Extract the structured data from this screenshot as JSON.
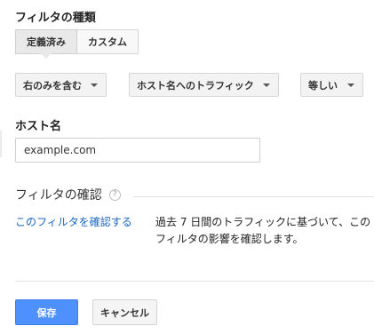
{
  "filter_type": {
    "title": "フィルタの種類",
    "options": [
      {
        "label": "定義済み",
        "selected": true
      },
      {
        "label": "カスタム",
        "selected": false
      }
    ]
  },
  "conditions": {
    "operator": "右のみを含む",
    "source": "ホスト名へのトラフィック",
    "match": "等しい"
  },
  "hostname": {
    "label": "ホスト名",
    "value": "example.com"
  },
  "verify": {
    "title": "フィルタの確認",
    "help_icon": "?",
    "link": "このフィルタを確認する",
    "description": "過去 7 日間のトラフィックに基づいて、この フィルタの影響を確認します。"
  },
  "actions": {
    "save": "保存",
    "cancel": "キャンセル"
  },
  "colors": {
    "primary_button": "#4d90fe",
    "link": "#1a66c4"
  }
}
